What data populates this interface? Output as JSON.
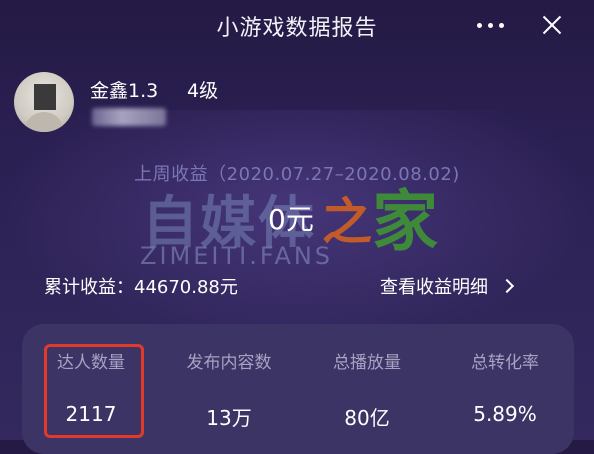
{
  "header": {
    "title": "小游戏数据报告"
  },
  "user": {
    "name": "金鑫1.3",
    "level": "4级"
  },
  "income": {
    "period": "上周收益（2020.07.27–2020.08.02)",
    "week_value": "0元",
    "total_label": "累计收益：44670.88元",
    "detail_link": "查看收益明细"
  },
  "watermark": {
    "big": "自媒体",
    "zhi": "之",
    "jia": "家",
    "small": "ZIMEITI.FANS"
  },
  "stats": [
    {
      "label": "达人数量",
      "value": "2117"
    },
    {
      "label": "发布内容数",
      "value": "13万"
    },
    {
      "label": "总播放量",
      "value": "80亿"
    },
    {
      "label": "总转化率",
      "value": "5.89%"
    }
  ],
  "colors": {
    "highlight": "#e23a2a",
    "period_text": "#7b76b5",
    "panel": "#3d3466"
  }
}
